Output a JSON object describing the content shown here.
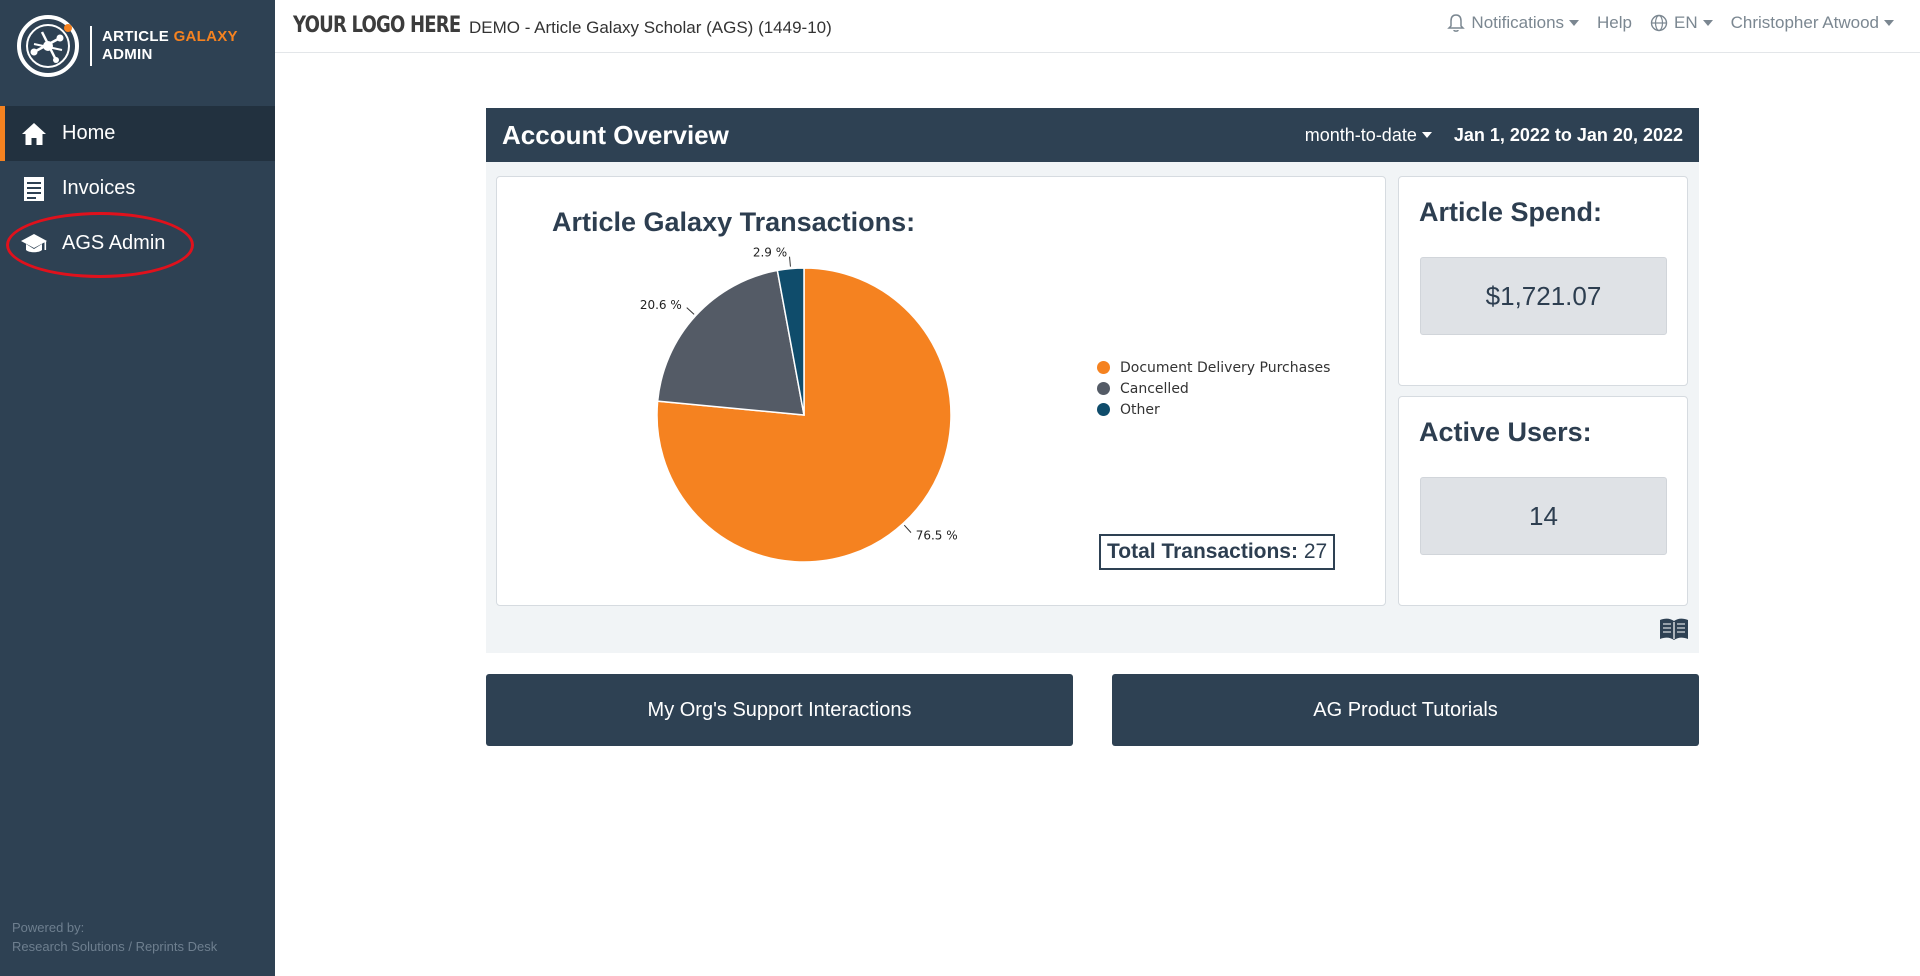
{
  "sidebar": {
    "brand": {
      "line1_white": "ARTICLE ",
      "line1_accent": "GALAXY",
      "line2": "ADMIN"
    },
    "items": [
      {
        "label": "Home",
        "icon": "home-icon",
        "active": true
      },
      {
        "label": "Invoices",
        "icon": "invoice-icon",
        "active": false
      },
      {
        "label": "AGS Admin",
        "icon": "graduation-cap-icon",
        "active": false
      }
    ],
    "powered_by": "Powered by:",
    "powered_company": "Research Solutions / Reprints Desk"
  },
  "topbar": {
    "logo_text": "YOUR LOGO HERE",
    "org_name": "DEMO - Article Galaxy Scholar (AGS) (1449-10)",
    "notifications_label": "Notifications",
    "help_label": "Help",
    "language_label": "EN",
    "user_name": "Christopher Atwood"
  },
  "overview": {
    "title": "Account Overview",
    "range_label": "month-to-date",
    "date_range": "Jan 1, 2022 to Jan 20, 2022",
    "transactions_title": "Article Galaxy Transactions:",
    "total_label": "Total Transactions:",
    "total_value": "27",
    "spend_title": "Article Spend:",
    "spend_value": "$1,721.07",
    "users_title": "Active Users:",
    "users_value": "14"
  },
  "chart_data": {
    "type": "pie",
    "title": "Article Galaxy Transactions:",
    "categories": [
      "Document Delivery Purchases",
      "Cancelled",
      "Other"
    ],
    "values": [
      76.5,
      20.6,
      2.9
    ],
    "labels": [
      "76.5 %",
      "20.6 %",
      "2.9 %"
    ],
    "colors": [
      "#f58220",
      "#545b66",
      "#0f4c6b"
    ],
    "legend_position": "right"
  },
  "buttons": {
    "support": "My Org's Support Interactions",
    "tutorials": "AG Product Tutorials"
  }
}
